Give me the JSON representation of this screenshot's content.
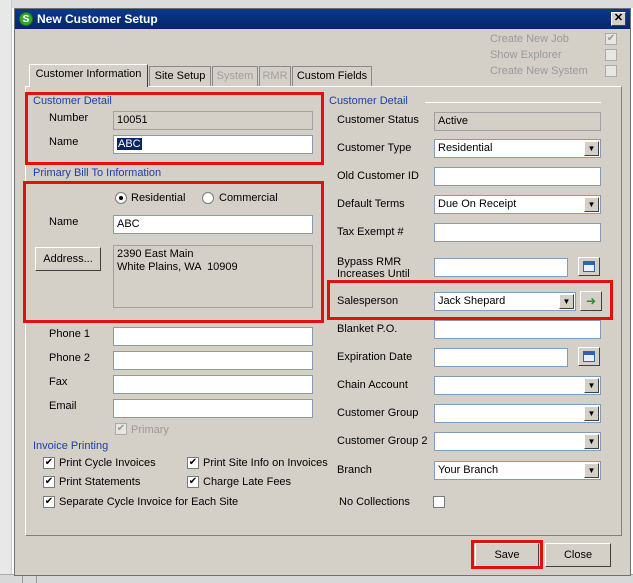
{
  "window": {
    "title": "New Customer Setup",
    "close_glyph": "✕",
    "app_icon_letter": "S"
  },
  "top_options": [
    {
      "label": "Create New Job",
      "checked": true
    },
    {
      "label": "Show Explorer",
      "checked": false
    },
    {
      "label": "Create New System",
      "checked": false
    }
  ],
  "tabs": [
    "Customer Information",
    "Site Setup",
    "System",
    "RMR",
    "Custom Fields"
  ],
  "customer_detail_left": {
    "group_label": "Customer Detail",
    "number_label": "Number",
    "number_value": "10051",
    "name_label": "Name",
    "name_value": "ABC"
  },
  "primary_bill_to": {
    "group_label": "Primary Bill To Information",
    "residential_label": "Residential",
    "commercial_label": "Commercial",
    "name_label": "Name",
    "name_value": "ABC",
    "address_button": "Address...",
    "address_value": "2390 East Main\nWhite Plains, WA  10909"
  },
  "contact": {
    "phone1_label": "Phone 1",
    "phone2_label": "Phone 2",
    "fax_label": "Fax",
    "email_label": "Email",
    "primary_label": "Primary"
  },
  "invoice_printing": {
    "group_label": "Invoice Printing",
    "print_cycle": "Print Cycle Invoices",
    "print_site_info": "Print Site Info on Invoices",
    "print_statements": "Print Statements",
    "charge_late_fees": "Charge Late Fees",
    "separate_cycle": "Separate Cycle Invoice for Each Site"
  },
  "customer_detail_right": {
    "group_label": "Customer Detail",
    "status_label": "Customer Status",
    "status_value": "Active",
    "type_label": "Customer Type",
    "type_value": "Residential",
    "old_id_label": "Old Customer ID",
    "terms_label": "Default Terms",
    "terms_value": "Due On Receipt",
    "tax_exempt_label": "Tax Exempt #",
    "bypass_label_1": "Bypass RMR",
    "bypass_label_2": "Increases Until",
    "salesperson_label": "Salesperson",
    "salesperson_value": "Jack Shepard",
    "blanket_po_label": "Blanket P.O.",
    "expiration_label": "Expiration Date",
    "chain_label": "Chain Account",
    "group_label_1": "Customer Group",
    "group_label_2": "Customer Group 2",
    "branch_label": "Branch",
    "branch_value": "Your Branch",
    "no_collections_label": "No Collections"
  },
  "buttons": {
    "save": "Save",
    "close": "Close"
  },
  "icons": {
    "dropdown": "▼",
    "check": "✔",
    "go_arrow": "➜"
  }
}
